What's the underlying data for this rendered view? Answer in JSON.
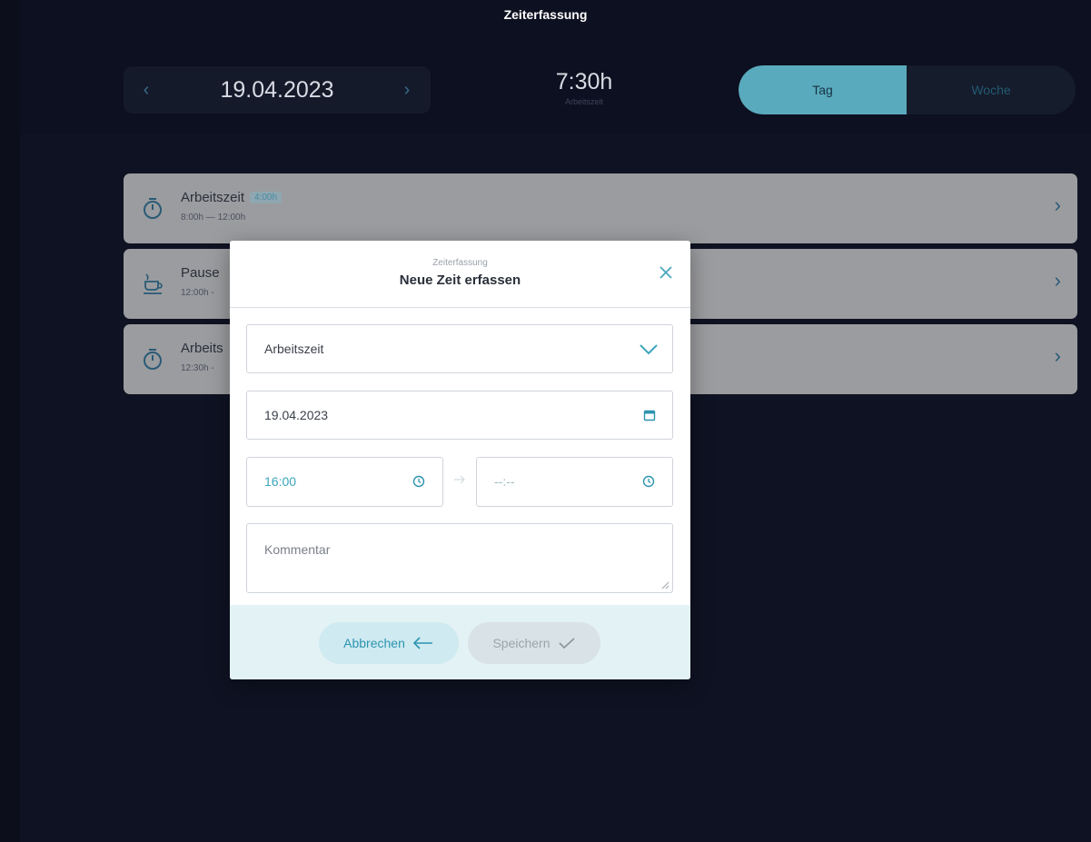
{
  "app": {
    "title": "Zeiterfassung"
  },
  "header": {
    "date": "19.04.2023",
    "total_value": "7:30h",
    "total_label": "Arbeitszeit",
    "view_toggle": {
      "active": "Tag",
      "inactive": "Woche"
    }
  },
  "entries": [
    {
      "title": "Arbeitszeit",
      "badge": "4:00h",
      "time": "8:00h — 12:00h",
      "icon": "stopwatch-icon"
    },
    {
      "title": "Pause",
      "badge": "",
      "time": "12:00h -",
      "icon": "coffee-cup-icon"
    },
    {
      "title": "Arbeits",
      "badge": "",
      "time": "12:30h -",
      "icon": "stopwatch-icon"
    }
  ],
  "modal": {
    "subtitle": "Zeiterfassung",
    "title": "Neue Zeit erfassen",
    "type_value": "Arbeitszeit",
    "date_value": "19.04.2023",
    "from_value": "16:00",
    "to_placeholder": "--:--",
    "comment_placeholder": "Kommentar",
    "cancel_label": "Abbrechen",
    "save_label": "Speichern"
  },
  "colors": {
    "accent": "#5aaabd",
    "background": "#0f1222",
    "card": "#9b9c9f",
    "footer": "#e3f2f4"
  }
}
